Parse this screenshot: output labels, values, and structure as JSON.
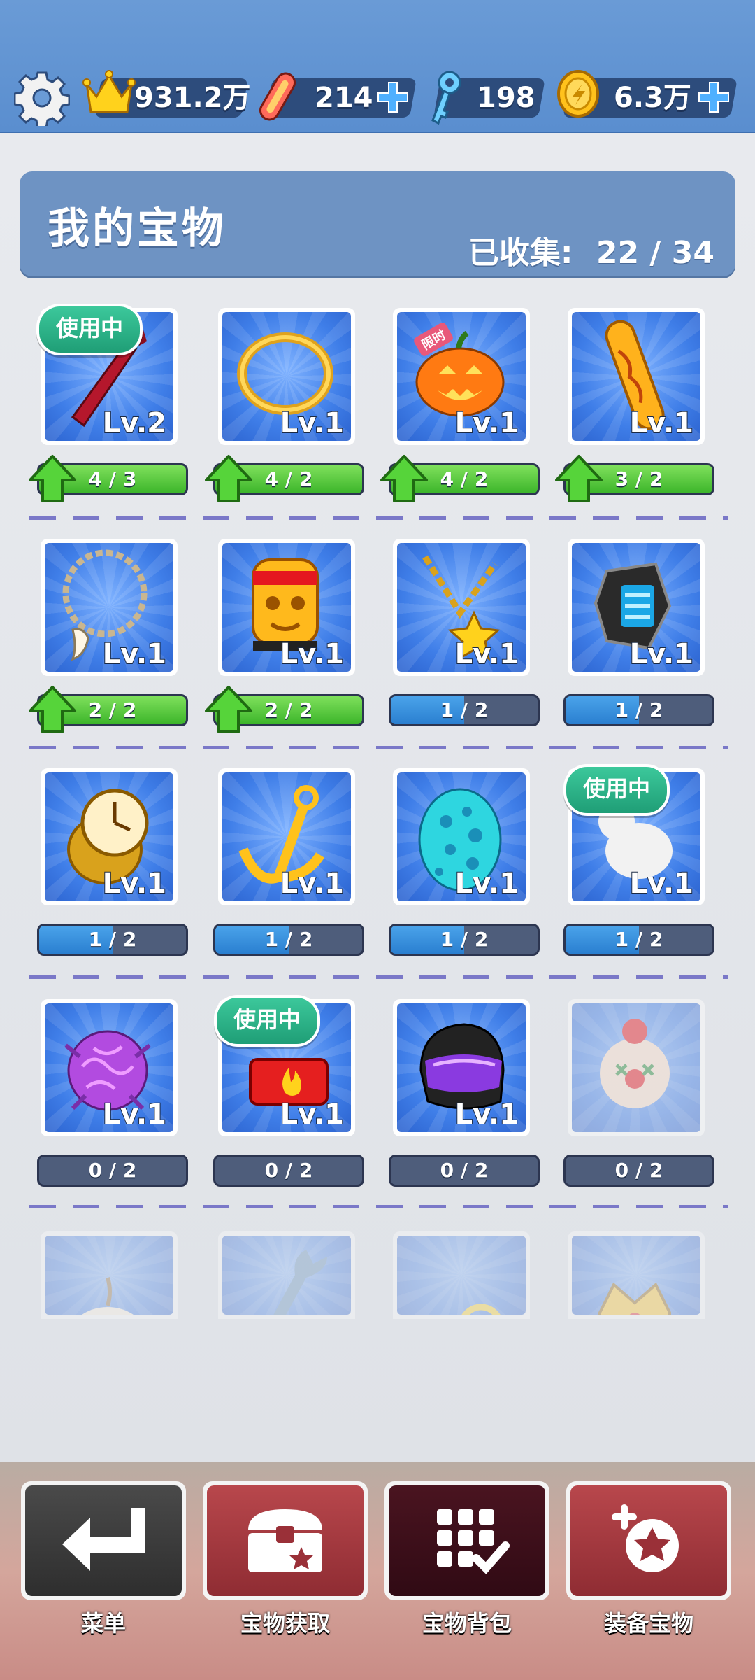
{
  "currency": {
    "crowns": "931.2万",
    "hoverboards": "214",
    "keys": "198",
    "coins": "6.3万"
  },
  "header": {
    "title": "我的宝物",
    "collected_label": "已收集:",
    "collected_value": "22 / 34"
  },
  "using_label": "使用中",
  "limited_label": "限时",
  "treasures": [
    {
      "level": "Lv.2",
      "progress": "4 / 3",
      "upgradable": true,
      "in_use": true,
      "icon": "guitar-icon"
    },
    {
      "level": "Lv.1",
      "progress": "4 / 2",
      "upgradable": true,
      "icon": "halo-ring-icon"
    },
    {
      "level": "Lv.1",
      "progress": "4 / 2",
      "upgradable": true,
      "icon": "pumpkin-icon"
    },
    {
      "level": "Lv.1",
      "progress": "3 / 2",
      "upgradable": true,
      "icon": "golden-skateboard-icon"
    },
    {
      "level": "Lv.1",
      "progress": "2 / 2",
      "upgradable": true,
      "icon": "tooth-necklace-icon"
    },
    {
      "level": "Lv.1",
      "progress": "2 / 2",
      "upgradable": true,
      "icon": "golden-idol-icon"
    },
    {
      "level": "Lv.1",
      "progress": "1 / 2",
      "upgradable": false,
      "icon": "star-necklace-icon"
    },
    {
      "level": "Lv.1",
      "progress": "1 / 2",
      "upgradable": false,
      "icon": "smartwatch-icon"
    },
    {
      "level": "Lv.1",
      "progress": "1 / 2",
      "upgradable": false,
      "icon": "gold-watch-icon"
    },
    {
      "level": "Lv.1",
      "progress": "1 / 2",
      "upgradable": false,
      "icon": "anchor-icon"
    },
    {
      "level": "Lv.1",
      "progress": "1 / 2",
      "upgradable": false,
      "icon": "spotted-egg-icon"
    },
    {
      "level": "Lv.1",
      "progress": "1 / 2",
      "upgradable": false,
      "in_use": true,
      "icon": "white-rabbit-icon"
    },
    {
      "level": "Lv.1",
      "progress": "0 / 2",
      "upgradable": false,
      "icon": "purple-brain-icon"
    },
    {
      "level": "Lv.1",
      "progress": "0 / 2",
      "upgradable": false,
      "in_use": true,
      "icon": "fire-box-icon"
    },
    {
      "level": "Lv.1",
      "progress": "0 / 2",
      "upgradable": false,
      "icon": "helmet-icon"
    },
    {
      "level": "",
      "progress": "0 / 2",
      "upgradable": false,
      "locked": true,
      "icon": "clown-mask-icon"
    },
    {
      "level": "",
      "progress": "",
      "locked": true,
      "icon": "onion-icon"
    },
    {
      "level": "",
      "progress": "",
      "locked": true,
      "icon": "wrench-icon"
    },
    {
      "level": "",
      "progress": "",
      "locked": true,
      "icon": "rings-icon"
    },
    {
      "level": "",
      "progress": "",
      "locked": true,
      "icon": "crown-icon"
    }
  ],
  "nav": {
    "menu": "菜单",
    "obtain": "宝物获取",
    "backpack": "宝物背包",
    "equip": "装备宝物"
  }
}
